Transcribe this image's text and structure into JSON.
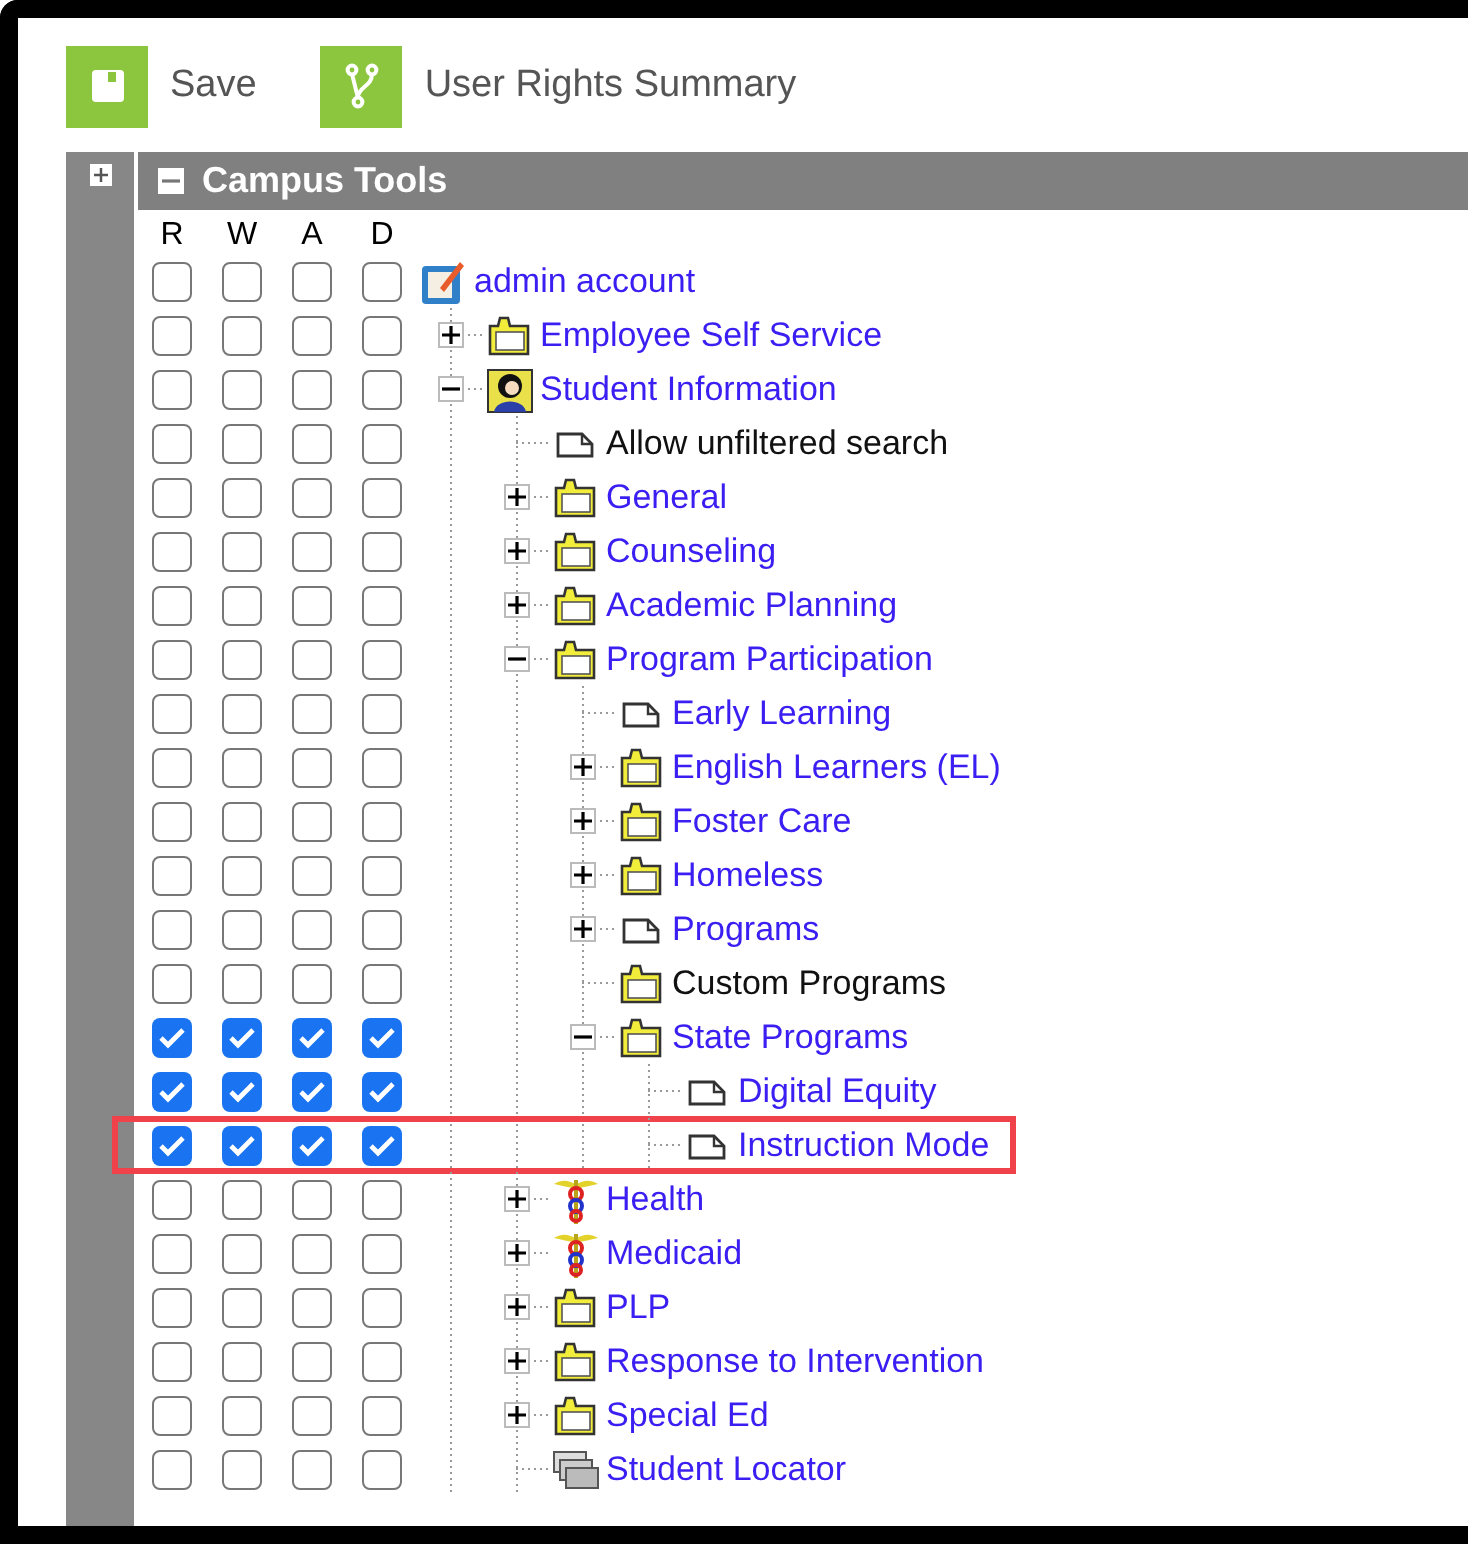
{
  "toolbar": [
    {
      "label": "Save",
      "kind": "save"
    },
    {
      "label": "User Rights Summary",
      "kind": "summary"
    }
  ],
  "side_panel": {
    "expanded": false
  },
  "panel": {
    "title": "Campus Tools",
    "expanded": true
  },
  "columns": [
    "R",
    "W",
    "A",
    "D"
  ],
  "tree": [
    {
      "label": "admin account",
      "kind": "admin",
      "link": true,
      "highlighted": false,
      "rights": [
        false,
        false,
        false,
        false
      ],
      "children": [
        {
          "label": "Employee Self Service",
          "kind": "folder",
          "link": true,
          "expanded": false,
          "highlighted": false,
          "rights": [
            false,
            false,
            false,
            false
          ]
        },
        {
          "label": "Student Information",
          "kind": "person",
          "link": true,
          "expanded": true,
          "highlighted": false,
          "rights": [
            false,
            false,
            false,
            false
          ],
          "children": [
            {
              "label": "Allow unfiltered search",
              "kind": "doc",
              "link": false,
              "highlighted": false,
              "rights": [
                false,
                false,
                false,
                false
              ]
            },
            {
              "label": "General",
              "kind": "folder",
              "link": true,
              "expanded": false,
              "highlighted": false,
              "rights": [
                false,
                false,
                false,
                false
              ]
            },
            {
              "label": "Counseling",
              "kind": "folder",
              "link": true,
              "expanded": false,
              "highlighted": false,
              "rights": [
                false,
                false,
                false,
                false
              ]
            },
            {
              "label": "Academic Planning",
              "kind": "folder",
              "link": true,
              "expanded": false,
              "highlighted": false,
              "rights": [
                false,
                false,
                false,
                false
              ]
            },
            {
              "label": "Program Participation",
              "kind": "folder",
              "link": true,
              "expanded": true,
              "highlighted": false,
              "rights": [
                false,
                false,
                false,
                false
              ],
              "children": [
                {
                  "label": "Early Learning",
                  "kind": "doc",
                  "link": true,
                  "highlighted": false,
                  "rights": [
                    false,
                    false,
                    false,
                    false
                  ]
                },
                {
                  "label": "English Learners (EL)",
                  "kind": "folder",
                  "link": true,
                  "expanded": false,
                  "highlighted": false,
                  "rights": [
                    false,
                    false,
                    false,
                    false
                  ]
                },
                {
                  "label": "Foster Care",
                  "kind": "folder",
                  "link": true,
                  "expanded": false,
                  "highlighted": false,
                  "rights": [
                    false,
                    false,
                    false,
                    false
                  ]
                },
                {
                  "label": "Homeless",
                  "kind": "folder",
                  "link": true,
                  "expanded": false,
                  "highlighted": false,
                  "rights": [
                    false,
                    false,
                    false,
                    false
                  ]
                },
                {
                  "label": "Programs",
                  "kind": "doc",
                  "link": true,
                  "expanded": false,
                  "highlighted": false,
                  "rights": [
                    false,
                    false,
                    false,
                    false
                  ]
                },
                {
                  "label": "Custom Programs",
                  "kind": "folder",
                  "link": false,
                  "highlighted": false,
                  "rights": [
                    false,
                    false,
                    false,
                    false
                  ]
                },
                {
                  "label": "State Programs",
                  "kind": "folder",
                  "link": true,
                  "expanded": true,
                  "highlighted": false,
                  "rights": [
                    true,
                    true,
                    true,
                    true
                  ],
                  "children": [
                    {
                      "label": "Digital Equity",
                      "kind": "doc",
                      "link": true,
                      "highlighted": false,
                      "rights": [
                        true,
                        true,
                        true,
                        true
                      ]
                    },
                    {
                      "label": "Instruction Mode",
                      "kind": "doc",
                      "link": true,
                      "highlighted": true,
                      "rights": [
                        true,
                        true,
                        true,
                        true
                      ]
                    }
                  ]
                }
              ]
            },
            {
              "label": "Health",
              "kind": "caduceus",
              "link": true,
              "expanded": false,
              "highlighted": false,
              "rights": [
                false,
                false,
                false,
                false
              ]
            },
            {
              "label": "Medicaid",
              "kind": "caduceus",
              "link": true,
              "expanded": false,
              "highlighted": false,
              "rights": [
                false,
                false,
                false,
                false
              ]
            },
            {
              "label": "PLP",
              "kind": "folder",
              "link": true,
              "expanded": false,
              "highlighted": false,
              "rights": [
                false,
                false,
                false,
                false
              ]
            },
            {
              "label": "Response to Intervention",
              "kind": "folder",
              "link": true,
              "expanded": false,
              "highlighted": false,
              "rights": [
                false,
                false,
                false,
                false
              ]
            },
            {
              "label": "Special Ed",
              "kind": "folder",
              "link": true,
              "expanded": false,
              "highlighted": false,
              "rights": [
                false,
                false,
                false,
                false
              ]
            },
            {
              "label": "Student Locator",
              "kind": "locator",
              "link": true,
              "highlighted": false,
              "rights": [
                false,
                false,
                false,
                false
              ]
            }
          ]
        }
      ]
    }
  ]
}
